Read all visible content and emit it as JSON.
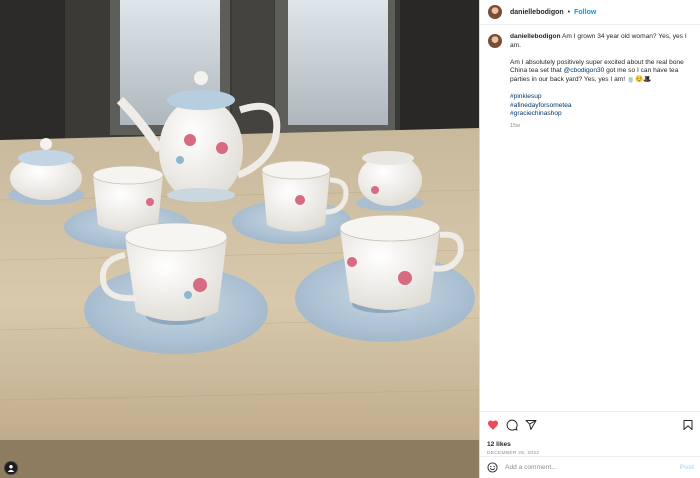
{
  "post": {
    "username": "daniellebodigon",
    "separator": "•",
    "follow_label": "Follow"
  },
  "caption": {
    "username": "daniellebodigon",
    "line1": "Am I grown 34 year old woman? Yes, yes I am.",
    "line2_pre": "Am I absolutely positively super excited about the real bone China tea set that ",
    "line2_mention": "@cbodigon30",
    "line2_post": " got me so I can have tea parties in our back yard? Yes, yes I am! 🍵☺️🎩",
    "hashtags": [
      "#pinkiesup",
      "#afinedayforsometea",
      "#graciechinashop"
    ],
    "time_ago": "15w"
  },
  "engagement": {
    "likes": "12 likes",
    "date": "DECEMBER 28, 2022",
    "liked": true,
    "like_color": "#ed4956"
  },
  "comment": {
    "placeholder": "Add a comment...",
    "post_label": "Post"
  },
  "icons": {
    "like": "heart-icon",
    "comment": "comment-icon",
    "share": "share-icon",
    "save": "bookmark-icon",
    "emoji": "emoji-icon",
    "tag": "user-tag-icon"
  },
  "colors": {
    "accent": "#0095f6",
    "link": "#00376b",
    "muted": "#8e8e8e"
  }
}
